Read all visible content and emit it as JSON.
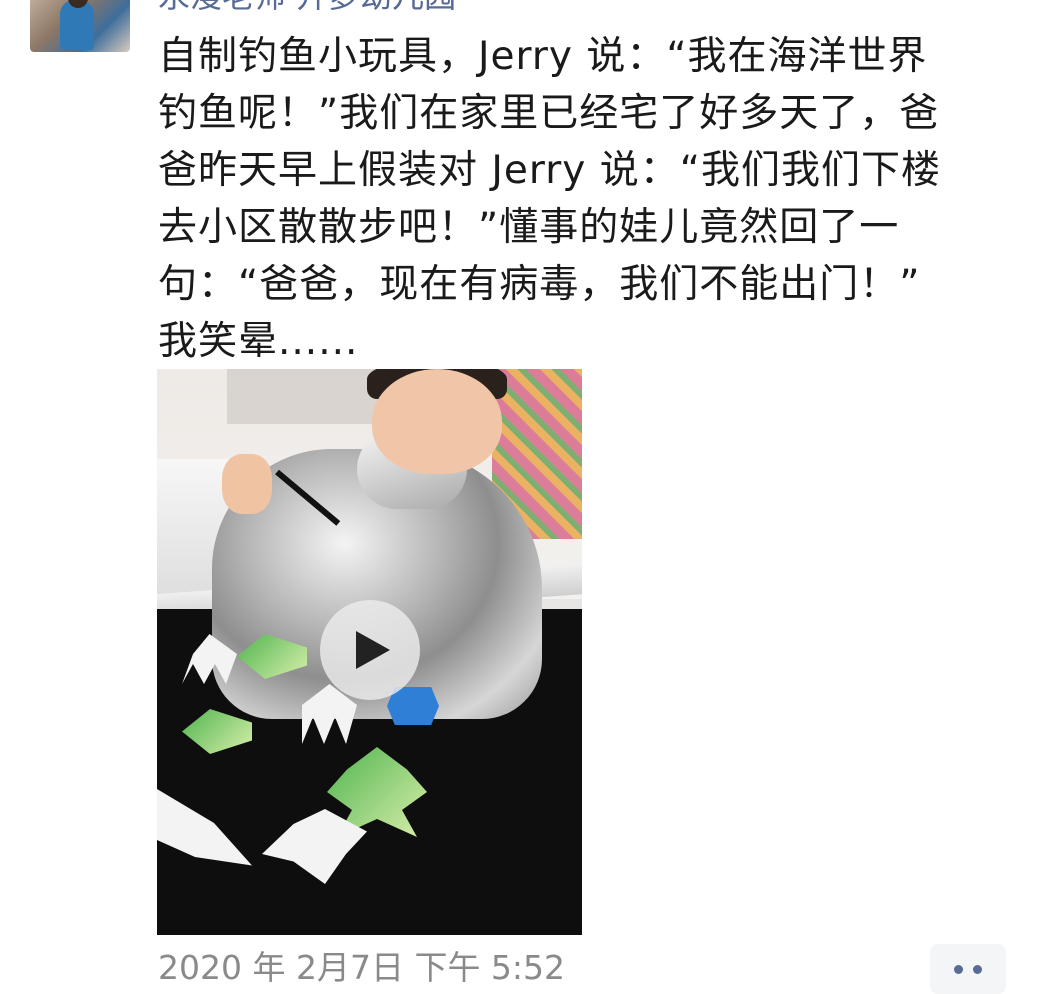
{
  "post": {
    "author": "永漫老师 开萝幼儿园",
    "text_lines": [
      "自制钓鱼小玩具，Jerry 说：“我在海洋世界",
      "钓鱼呢！”我们在家里已经宅了好多天了，爸",
      "爸昨天早上假装对 Jerry 说：“我们我们下楼",
      "去小区散散步吧！”懂事的娃儿竟然回了一",
      "句：“爸爸，现在有病毒，我们不能出门！”",
      "我笑晕......"
    ],
    "timestamp": "2020 年 2月7日  下午 5:52",
    "video": {
      "play_icon": "play-icon"
    },
    "more_icon": "more-dots-icon"
  }
}
